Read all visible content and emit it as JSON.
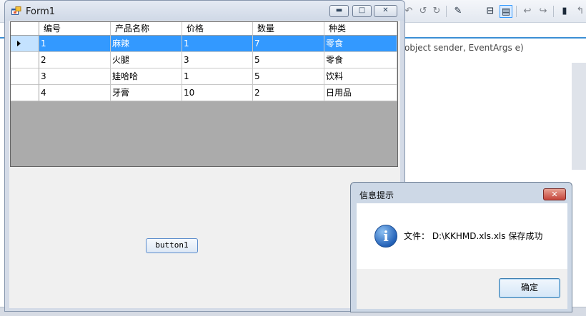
{
  "ide": {
    "code_snippet": "object sender, EventArgs e)"
  },
  "form1": {
    "title": "Form1",
    "window_buttons": {
      "minimize": "▬",
      "maximize": "□",
      "close": "✕"
    },
    "grid": {
      "columns": [
        "编号",
        "产品名称",
        "价格",
        "数量",
        "种类"
      ],
      "rows": [
        [
          "1",
          "麻辣",
          "1",
          "7",
          "零食"
        ],
        [
          "2",
          "火腿",
          "3",
          "5",
          "零食"
        ],
        [
          "3",
          "娃哈哈",
          "1",
          "5",
          "饮料"
        ],
        [
          "4",
          "牙膏",
          "10",
          "2",
          "日用品"
        ]
      ],
      "selected_row": 0
    },
    "button1_label": "button1"
  },
  "msgbox": {
    "title": "信息提示",
    "close_label": "✕",
    "message": "文件： D:\\KKHMD.xls.xls 保存成功",
    "ok_label": "确定"
  }
}
